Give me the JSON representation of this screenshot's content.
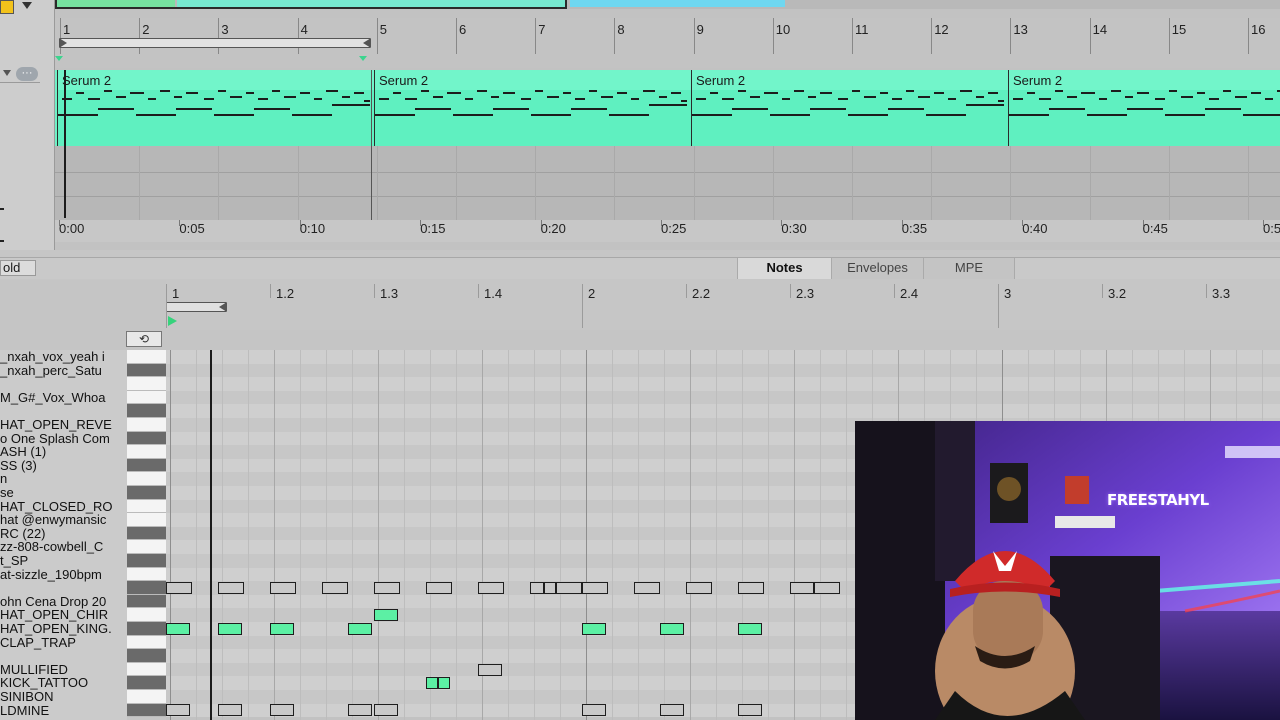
{
  "arrangement": {
    "bar_numbers": [
      "1",
      "2",
      "3",
      "4",
      "5",
      "6",
      "7",
      "8",
      "9",
      "10",
      "11",
      "12",
      "13",
      "14",
      "15",
      "16"
    ],
    "clips": [
      {
        "name": "Serum 2"
      },
      {
        "name": "Serum 2"
      },
      {
        "name": "Serum 2"
      },
      {
        "name": "Serum 2"
      }
    ],
    "time_labels": [
      "0:00",
      "0:05",
      "0:10",
      "0:15",
      "0:20",
      "0:25",
      "0:30",
      "0:35",
      "0:40",
      "0:45",
      "0:5"
    ],
    "track_more_glyph": "···"
  },
  "detail": {
    "fold_label": "old",
    "tabs": [
      {
        "label": "Notes",
        "active": true
      },
      {
        "label": "Envelopes",
        "active": false
      },
      {
        "label": "MPE",
        "active": false
      }
    ]
  },
  "editor": {
    "beat_labels": [
      "1",
      "1.2",
      "1.3",
      "1.4",
      "2",
      "2.2",
      "2.3",
      "2.4",
      "3",
      "3.2",
      "3.3"
    ],
    "loop_glyph": "⟲",
    "drum_rows": [
      "_nxah_vox_yeah i",
      "_nxah_perc_Satu",
      "",
      "M_G#_Vox_Whoa",
      "",
      "HAT_OPEN_REVE",
      "o One Splash Com",
      "ASH (1)",
      "SS (3)",
      "n",
      "se",
      "HAT_CLOSED_RO",
      "hat @enwymansic",
      "RC (22)",
      "zz-808-cowbell_C",
      "t_SP",
      "at-sizzle_190bpm",
      "",
      "ohn Cena Drop 20",
      "HAT_OPEN_CHIR",
      "HAT_OPEN_KING.",
      "CLAP_TRAP",
      "",
      "MULLIFIED",
      "KICK_TATTOO",
      "SINIBON",
      "LDMINE"
    ]
  },
  "colors": {
    "clip": "#6ff0c6",
    "note_active": "#5cf0a4",
    "note_muted": "#c9c9c9",
    "flag": "#3cd48e",
    "warning": "#f2c21b"
  },
  "webcam": {
    "sign_text": "FREESTAHYL"
  }
}
